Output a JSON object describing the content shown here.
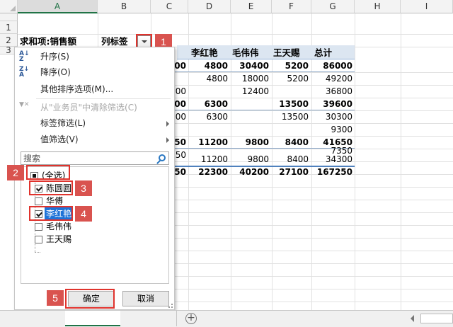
{
  "columns": [
    "A",
    "B",
    "C",
    "D",
    "E",
    "F",
    "G",
    "H",
    "I"
  ],
  "rows": [
    "1",
    "2",
    "3"
  ],
  "pivot": {
    "row_label": "求和项:销售额",
    "col_label": "列标签",
    "col_headers": [
      "李红艳",
      "毛伟伟",
      "王天赐",
      "总计"
    ],
    "c_column": [
      "000",
      "",
      "000",
      "6300",
      "300",
      "",
      "650",
      "350",
      "",
      "250"
    ],
    "d_column": [
      "4800",
      "4800",
      "",
      "6300",
      "6300",
      "",
      "11200",
      "",
      "11200",
      "22300"
    ],
    "e_column": [
      "30400",
      "18000",
      "12400",
      "",
      "",
      "",
      "9800",
      "",
      "9800",
      "40200"
    ],
    "f_column": [
      "5200",
      "5200",
      "",
      "13500",
      "13500",
      "",
      "8400",
      "",
      "8400",
      "27100"
    ],
    "g_column": [
      "86000",
      "49200",
      "36800",
      "39600",
      "30300",
      "9300",
      "41650",
      "7350",
      "34300",
      "167250"
    ]
  },
  "menu": {
    "sort_asc": "升序(S)",
    "sort_desc": "降序(O)",
    "more_sort": "其他排序选项(M)...",
    "clear_filter": "从\"业务员\"中清除筛选(C)",
    "label_filter": "标签筛选(L)",
    "value_filter": "值筛选(V)",
    "search_placeholder": "搜索",
    "items": [
      {
        "label": "(全选)",
        "state": "partial"
      },
      {
        "label": "陈圆圆",
        "state": "checked"
      },
      {
        "label": "华傅",
        "state": "unchecked"
      },
      {
        "label": "李红艳",
        "state": "checked"
      },
      {
        "label": "毛伟伟",
        "state": "unchecked"
      },
      {
        "label": "王天赐",
        "state": "unchecked"
      }
    ],
    "ok": "确定",
    "cancel": "取消"
  },
  "callouts": [
    "1",
    "2",
    "3",
    "4",
    "5"
  ],
  "icons": {
    "sort_asc": "sort-ascending-icon",
    "sort_desc": "sort-descending-icon",
    "clear": "clear-filter-icon",
    "search": "search-icon"
  },
  "tabs": {
    "add_label": "+"
  },
  "colors": {
    "callout": "#d9534f",
    "highlight": "#1e73d8",
    "header_band": "#dce6f1",
    "excel_green": "#217346"
  }
}
